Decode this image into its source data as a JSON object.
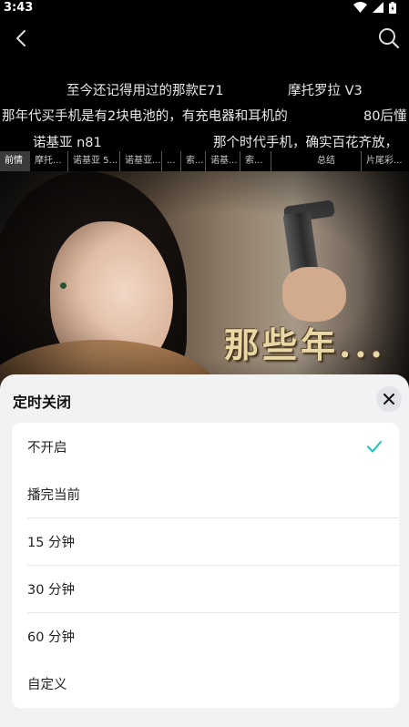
{
  "status_bar": {
    "time": "3:43"
  },
  "danmaku": [
    {
      "text": "至今还记得用过的那款E71"
    },
    {
      "text": "摩托罗拉 V3"
    },
    {
      "text": "那年代买手机是有2块电池的，有充电器和耳机的"
    },
    {
      "text": "80后懂"
    },
    {
      "text": "诺基亚 n81"
    },
    {
      "text": "那个时代手机，确实百花齐放，"
    }
  ],
  "chapters": [
    "前情",
    "摩托...",
    "诺基亚 5...",
    "诺基亚...",
    "...",
    "索...",
    "诺基...",
    "索...",
    "总结",
    "片尾彩..."
  ],
  "video": {
    "subtitle": "那些年..."
  },
  "sheet": {
    "title": "定时关闭",
    "options": [
      {
        "label": "不开启",
        "selected": true
      },
      {
        "label": "播完当前",
        "selected": false
      },
      {
        "label": "15 分钟",
        "selected": false
      },
      {
        "label": "30 分钟",
        "selected": false
      },
      {
        "label": "60 分钟",
        "selected": false
      },
      {
        "label": "自定义",
        "selected": false
      }
    ]
  },
  "colors": {
    "accent": "#19c2b5",
    "sheet_bg": "#f1f2f4"
  },
  "icons": {
    "back": "chevron-left-icon",
    "search": "search-icon",
    "close": "close-icon",
    "check": "check-icon"
  }
}
